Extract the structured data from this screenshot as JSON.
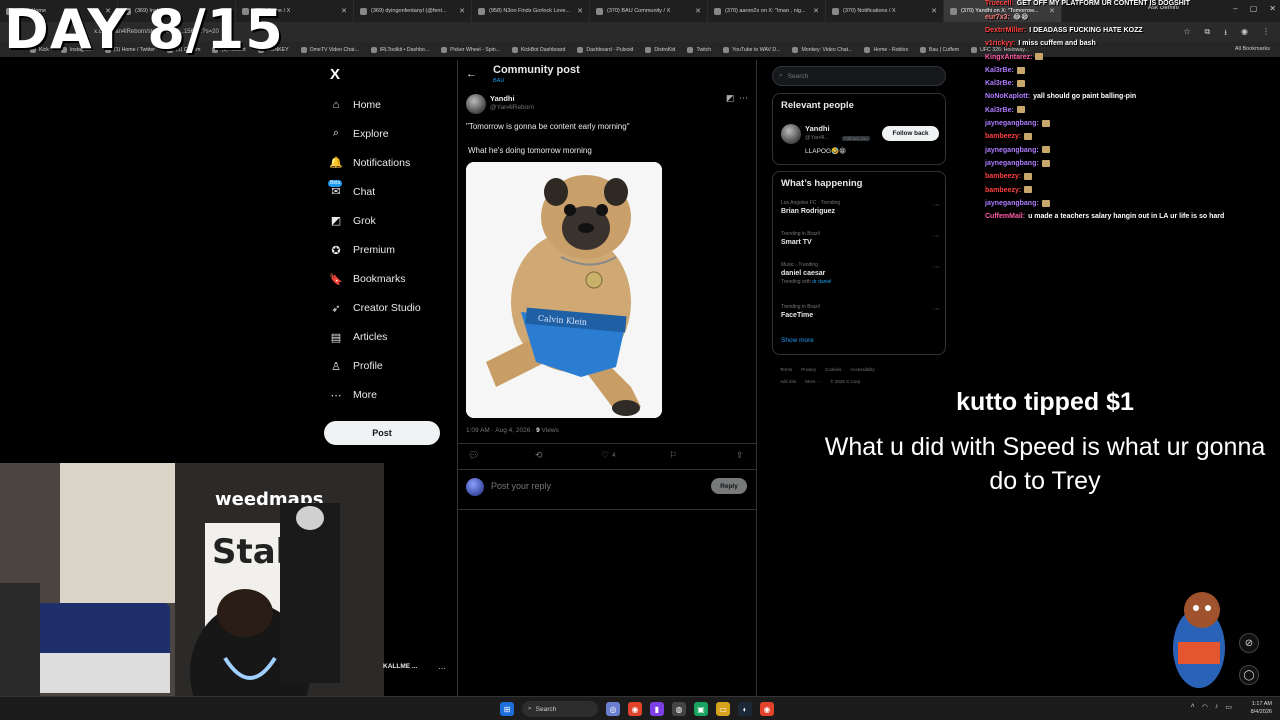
{
  "overlay": {
    "day_counter": "DAY 8/15"
  },
  "browser": {
    "tabs": [
      {
        "label": "(370) Home"
      },
      {
        "label": "(369) Instagram"
      },
      {
        "label": "(370) Home / X"
      },
      {
        "label": "(369) dyingonfentanyl (@fent..."
      },
      {
        "label": "(958) N3on Finds Gorlock Love..."
      },
      {
        "label": "(370) BAU Community / X"
      },
      {
        "label": "(370) aaron2x on X: \"lmao , nig..."
      },
      {
        "label": "(370) Notifications / X"
      },
      {
        "label": "(370) Yandhi on X: \"Tomorrow..."
      }
    ],
    "url": "x.com/Yan4lReborn/status/2054...1564...?s=20",
    "ask_gemini": "Ask Gemini",
    "bookmarks": [
      "Kick",
      "Instagram",
      "(1) Home / Twitter",
      "(1) Cuffem",
      "(1) Recent",
      "DONKEY",
      "OmeTV Video Chat...",
      "IRLToolkit • Dashbo...",
      "Picker Wheel - Spin...",
      "KickBot Dashboard",
      "Dashboard - Pulsoid",
      "DistroKid",
      "Twitch",
      "YouTube to WAV D...",
      "Monkey: Video Chat...",
      "Home - Roblox",
      "Bau | Cuffem",
      "UFC 326: Holloway..."
    ],
    "all_bookmarks": "All Bookmarks"
  },
  "nav": {
    "logo": "X",
    "items": [
      {
        "label": "Home",
        "icon": "home-icon",
        "glyph": "⌂"
      },
      {
        "label": "Explore",
        "icon": "search-icon",
        "glyph": "⌕"
      },
      {
        "label": "Notifications",
        "icon": "bell-icon",
        "glyph": "🔔"
      },
      {
        "label": "Chat",
        "icon": "chat-icon",
        "glyph": "✉"
      },
      {
        "label": "Grok",
        "icon": "grok-icon",
        "glyph": "◩"
      },
      {
        "label": "Premium",
        "icon": "premium-icon",
        "glyph": "✪"
      },
      {
        "label": "Bookmarks",
        "icon": "bookmark-icon",
        "glyph": "🔖"
      },
      {
        "label": "Creator Studio",
        "icon": "rocket-icon",
        "glyph": "➶"
      },
      {
        "label": "Articles",
        "icon": "article-icon",
        "glyph": "▤"
      },
      {
        "label": "Profile",
        "icon": "person-icon",
        "glyph": "♙"
      },
      {
        "label": "More",
        "icon": "more-icon",
        "glyph": "⋯"
      }
    ],
    "chat_badge": "Beta",
    "post_button": "Post"
  },
  "main": {
    "title": "Community post",
    "subtitle": "BAU",
    "post": {
      "name": "Yandhi",
      "handle": "@Yan4lReborn",
      "text1": "\"Tomorrow is gonna be content early morning\"",
      "text2": "What he's doing tomorrow morning",
      "time": "1:09 AM · Aug 4, 2026 · ",
      "views_count": "9",
      "views_label": " Views",
      "likes": "4"
    },
    "reply_placeholder": "Post your reply",
    "reply_button": "Reply"
  },
  "sidebar": {
    "search_placeholder": "Search",
    "relevant_title": "Relevant people",
    "relevant": {
      "name": "Yandhi",
      "handle": "@Yan4l...",
      "follows_you": "Follows you",
      "bio": "LLAPOG🤣😁",
      "follow_button": "Follow back"
    },
    "happening_title": "What’s happening",
    "trends": [
      {
        "context": "Los Angeles FC · Trending",
        "name": "Brian Rodriguez",
        "with": "",
        "with_link": ""
      },
      {
        "context": "Trending in Brazil",
        "name": "Smart TV",
        "with": "",
        "with_link": ""
      },
      {
        "context": "Music · Trending",
        "name": "daniel caesar",
        "with": "Trending with ",
        "with_link": "dr daniel"
      },
      {
        "context": "Trending in Brazil",
        "name": "FaceTime",
        "with": "",
        "with_link": ""
      }
    ],
    "show_more": "Show more",
    "footer1": [
      "Terms",
      "Privacy",
      "Cookies",
      "Accessibility"
    ],
    "footer2": [
      "Ads info",
      "More ···",
      "© 2026 X Corp."
    ]
  },
  "chat": {
    "messages": [
      {
        "user": "Truecell:",
        "text": "GET OFF MY PLATFORM UR CONTENT IS DOGSHIT",
        "color": "#ff4040"
      },
      {
        "user": "eur7x3:",
        "text": "😂😁",
        "color": "#ff7b7b"
      },
      {
        "user": "DextrrMiller:",
        "text": "I DEADASS FUCKING HATE KOZZ",
        "color": "#ff4040"
      },
      {
        "user": "v1rickyy:",
        "text": "I miss cuffem and bash",
        "color": "#ff4040"
      },
      {
        "user": "KingxAntarez:",
        "text": "",
        "color": "#ff5aa8"
      },
      {
        "user": "Kal3rBe:",
        "text": "",
        "color": "#b07cff"
      },
      {
        "user": "Kal3rBe:",
        "text": "",
        "color": "#b07cff"
      },
      {
        "user": "NoNoKaplott:",
        "text": "yall should go paint balling-pin",
        "color": "#b07cff"
      },
      {
        "user": "Kal3rBe:",
        "text": "",
        "color": "#b07cff"
      },
      {
        "user": "jaynegangbang:",
        "text": "",
        "color": "#b07cff"
      },
      {
        "user": "bambeezy:",
        "text": "",
        "color": "#ff4040"
      },
      {
        "user": "jaynegangbang:",
        "text": "",
        "color": "#b07cff"
      },
      {
        "user": "jaynegangbang:",
        "text": "",
        "color": "#b07cff"
      },
      {
        "user": "bambeezy:",
        "text": "",
        "color": "#ff4040"
      },
      {
        "user": "bambeezy:",
        "text": "",
        "color": "#ff4040"
      },
      {
        "user": "jaynegangbang:",
        "text": "",
        "color": "#b07cff"
      },
      {
        "user": "CuffemMail:",
        "text": "u made a teachers salary hangin out in LA ur life is so hard",
        "color": "#ff5aa8"
      }
    ]
  },
  "tip": {
    "title": "kutto tipped $1",
    "message": "What u did with Speed is what ur gonna do to Trey"
  },
  "webcam": {
    "sign_text": "weedmaps",
    "banner_text": "Stake",
    "profile_name": "KALLME ..."
  },
  "taskbar": {
    "search": "Search",
    "time": "1:17 AM",
    "date": "8/4/2026"
  },
  "colors": {
    "accent": "#1d9bf0",
    "background": "#000000",
    "border": "#2f3336"
  }
}
